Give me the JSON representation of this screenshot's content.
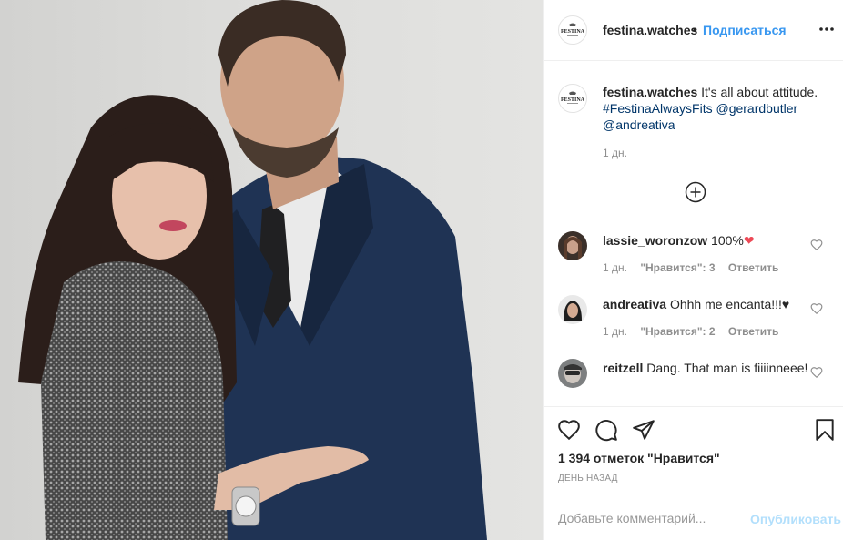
{
  "colors": {
    "accent": "#3897f0",
    "link": "#003569",
    "text": "#262626",
    "muted": "#8e8e8e",
    "publish_disabled": "#b2dffc",
    "heart_red": "#ed4956"
  },
  "header": {
    "username": "festina.watches",
    "separator": "•",
    "follow_label": "Подписаться",
    "more_icon": "more-icon"
  },
  "brand": {
    "logo_text": "FESTINA"
  },
  "caption": {
    "username": "festina.watches",
    "text": "It's all about attitude.",
    "hashtag": "#FestinaAlwaysFits",
    "mention1": "@gerardbutler",
    "mention2": "@andreativa",
    "time": "1 дн."
  },
  "comments": [
    {
      "username": "lassie_woronzow",
      "text": "100%",
      "emoji": "❤",
      "time": "1 дн.",
      "likes": "\"Нравится\": 3",
      "reply": "Ответить"
    },
    {
      "username": "andreativa",
      "text": "Ohhh me encanta!!!",
      "emoji": "♥",
      "time": "1 дн.",
      "likes": "\"Нравится\": 2",
      "reply": "Ответить"
    },
    {
      "username": "reitzell",
      "text": "Dang. That man is fiiiinneee!"
    }
  ],
  "actions": {
    "likes_count": "1 394 отметок \"Нравится\"",
    "posted": "День назад"
  },
  "add_comment": {
    "placeholder": "Добавьте комментарий...",
    "publish_label": "Опубликовать"
  }
}
